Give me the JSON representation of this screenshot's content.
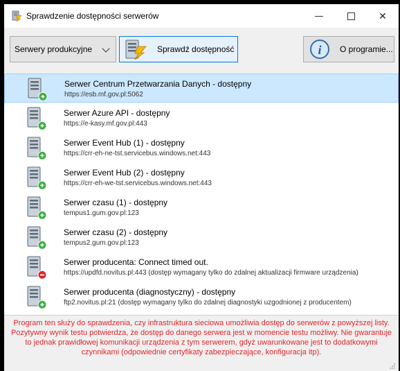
{
  "window": {
    "title": "Sprawdzenie dostępności serwerów",
    "icon": "app-server-icon"
  },
  "toolbar": {
    "server_group_selected": "Serwery produkcyjne",
    "check_label": "Sprawdź dostępność",
    "about_label": "O programie..."
  },
  "servers": [
    {
      "name": "Serwer Centrum Przetwarzania Danych - dostępny",
      "address": "https://esb.mf.gov.pl:5062",
      "status": "ok",
      "selected": true
    },
    {
      "name": "Serwer Azure API - dostępny",
      "address": "https://e-kasy.mf.gov.pl:443",
      "status": "ok",
      "selected": false
    },
    {
      "name": "Serwer Event Hub (1) - dostępny",
      "address": "https://crr-eh-ne-tst.servicebus.windows.net:443",
      "status": "ok",
      "selected": false
    },
    {
      "name": "Serwer Event Hub (2) - dostępny",
      "address": "https://crr-eh-we-tst.servicebus.windows.net:443",
      "status": "ok",
      "selected": false
    },
    {
      "name": "Serwer czasu (1) - dostępny",
      "address": "tempus1.gum.gov.pl:123",
      "status": "ok",
      "selected": false
    },
    {
      "name": "Serwer czasu (2) - dostępny",
      "address": "tempus2.gum.gov.pl:123",
      "status": "ok",
      "selected": false
    },
    {
      "name": "Serwer producenta: Connect timed out.",
      "address": "https://updfd.novitus.pl:443 (dostęp wymagany tylko do zdalnej aktualizacji firmware urządzenia)",
      "status": "error",
      "selected": false
    },
    {
      "name": "Serwer producenta (diagnostyczny) - dostępny",
      "address": "ftp2.novitus.pl:21 (dostęp wymagany tylko do zdalnej diagnostyki uzgodnionej z producentem)",
      "status": "ok",
      "selected": false
    }
  ],
  "info_text": "Program ten służy do sprawdzenia, czy infrastruktura sieciowa umożliwia dostęp do serwerów z powyższej listy. Pozytywny wynik testu potwierdza, że dostęp do danego serwera jest w momencie testu możliwy. Nie gwarantuje to jednak prawidłowej komunikacji urządzenia z tym serwerem, gdyż uwarunkowane jest to dodatkowymi czynnikami (odpowiednie certyfikaty zabezpieczające, konfiguracja itp).",
  "colors": {
    "selection": "#cce8ff",
    "ok_badge": "#3cb043",
    "error_badge": "#e0252b",
    "info_text": "#e0252b",
    "accent": "#0078d7"
  }
}
